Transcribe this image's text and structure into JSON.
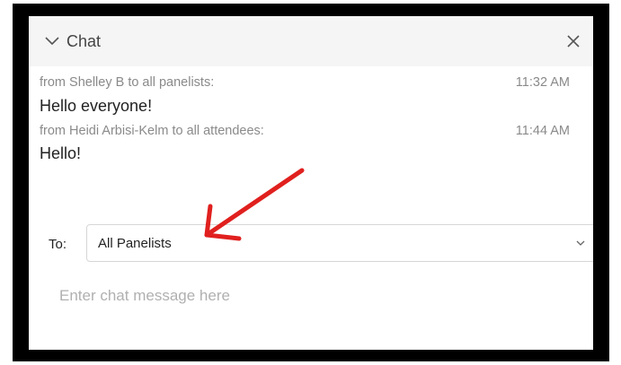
{
  "chat": {
    "title": "Chat",
    "messages": [
      {
        "meta": "from Shelley B to all panelists:",
        "time": "11:32 AM",
        "text": "Hello everyone!"
      },
      {
        "meta": "from Heidi Arbisi-Kelm to all attendees:",
        "time": "11:44 AM",
        "text": "Hello!"
      }
    ],
    "to_label": "To:",
    "to_value": "All Panelists",
    "input_placeholder": "Enter chat message here"
  },
  "icons": {
    "collapse": "chevron-down-icon",
    "close": "close-icon",
    "dropdown": "chevron-down-icon",
    "annotation": "red-arrow-annotation"
  },
  "colors": {
    "frame": "#000000",
    "header_bg": "#f5f5f5",
    "meta_text": "#8a8a8a",
    "annotation_arrow": "#e0201e"
  }
}
